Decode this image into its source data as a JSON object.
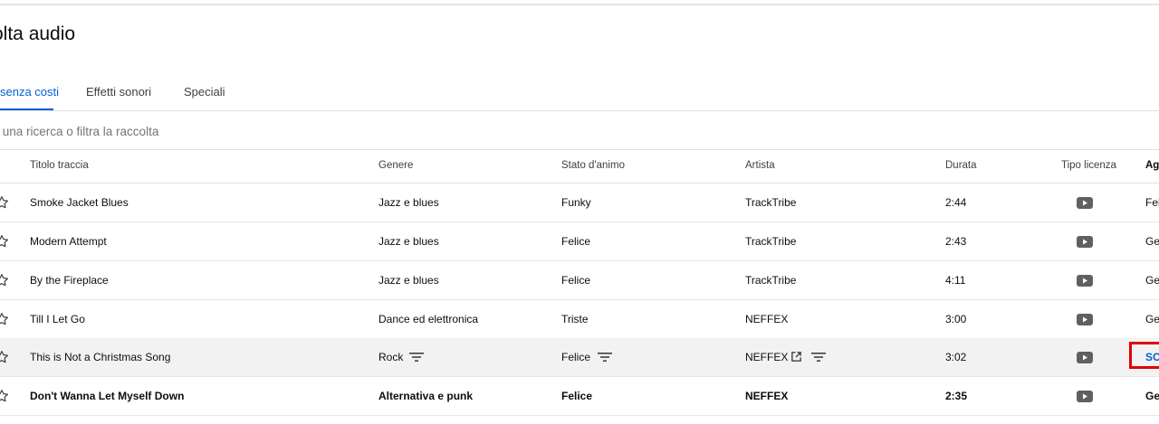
{
  "page": {
    "title": "olta audio"
  },
  "tabs": [
    {
      "label": "senza costi",
      "active": true
    },
    {
      "label": "Effetti sonori",
      "active": false
    },
    {
      "label": "Speciali",
      "active": false
    }
  ],
  "filter": {
    "placeholder": "i una ricerca o filtra la raccolta",
    "value": ""
  },
  "table": {
    "columns": {
      "title": "Titolo traccia",
      "genre": "Genere",
      "mood": "Stato d'animo",
      "artist": "Artista",
      "duration": "Durata",
      "license": "Tipo licenza",
      "added": "Agg"
    },
    "rows": [
      {
        "title": "Smoke Jacket Blues",
        "genre": "Jazz e blues",
        "mood": "Funky",
        "artist": "TrackTribe",
        "duration": "2:44",
        "license_icon": "youtube-icon",
        "added": "Feb",
        "hover": false,
        "bold": false
      },
      {
        "title": "Modern Attempt",
        "genre": "Jazz e blues",
        "mood": "Felice",
        "artist": "TrackTribe",
        "duration": "2:43",
        "license_icon": "youtube-icon",
        "added": "Ger",
        "hover": false,
        "bold": false
      },
      {
        "title": "By the Fireplace",
        "genre": "Jazz e blues",
        "mood": "Felice",
        "artist": "TrackTribe",
        "duration": "4:11",
        "license_icon": "youtube-icon",
        "added": "Ger",
        "hover": false,
        "bold": false
      },
      {
        "title": "Till I Let Go",
        "genre": "Dance ed elettronica",
        "mood": "Triste",
        "artist": "NEFFEX",
        "duration": "3:00",
        "license_icon": "youtube-icon",
        "added": "Ger",
        "hover": false,
        "bold": false
      },
      {
        "title": "This is Not a Christmas Song",
        "genre": "Rock",
        "mood": "Felice",
        "artist": "NEFFEX",
        "duration": "3:02",
        "license_icon": "youtube-icon",
        "added": "SC",
        "hover": true,
        "bold": false
      },
      {
        "title": "Don't Wanna Let Myself Down",
        "genre": "Alternativa e punk",
        "mood": "Felice",
        "artist": "NEFFEX",
        "duration": "2:35",
        "license_icon": "youtube-icon",
        "added": "Ger",
        "hover": false,
        "bold": true
      }
    ]
  },
  "colors": {
    "accent": "#065fd4",
    "highlight": "#e00000",
    "hover_row": "#f2f2f2"
  },
  "icons": {
    "star": "star-outline-icon",
    "license": "youtube-icon",
    "filter": "filter-icon",
    "external": "external-link-icon"
  }
}
